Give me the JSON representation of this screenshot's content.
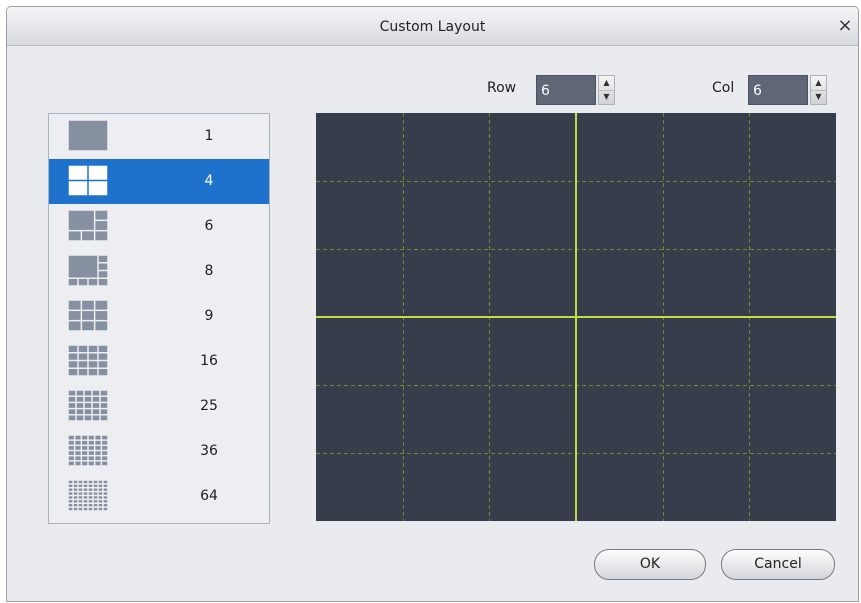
{
  "dialog": {
    "title": "Custom Layout",
    "close_glyph": "×"
  },
  "grid_controls": {
    "row": {
      "label": "Row",
      "value": "6",
      "up": "▲",
      "down": "▼"
    },
    "col": {
      "label": "Col",
      "value": "6",
      "up": "▲",
      "down": "▼"
    }
  },
  "layout_list": {
    "selected_index": 1,
    "items": [
      {
        "label": "1",
        "icon": "layout-1-icon",
        "division": 1
      },
      {
        "label": "4",
        "icon": "layout-4-icon",
        "division": 4
      },
      {
        "label": "6",
        "icon": "layout-6-icon",
        "division": 6
      },
      {
        "label": "8",
        "icon": "layout-8-icon",
        "division": 8
      },
      {
        "label": "9",
        "icon": "layout-9-icon",
        "division": 9
      },
      {
        "label": "16",
        "icon": "layout-16-icon",
        "division": 16
      },
      {
        "label": "25",
        "icon": "layout-25-icon",
        "division": 25
      },
      {
        "label": "36",
        "icon": "layout-36-icon",
        "division": 36
      },
      {
        "label": "64",
        "icon": "layout-64-icon",
        "division": 64
      }
    ]
  },
  "preview": {
    "rows": 6,
    "cols": 6,
    "merged_split_rows": 2,
    "merged_split_cols": 2,
    "colors": {
      "background": "#373d4b",
      "grid_line": "#6f8a2a",
      "split_line": "#c2dc48"
    }
  },
  "buttons": {
    "ok": "OK",
    "cancel": "Cancel"
  },
  "colors": {
    "selection": "#1f72cc",
    "icon": "#8790a0",
    "icon_selected": "#ffffff"
  }
}
